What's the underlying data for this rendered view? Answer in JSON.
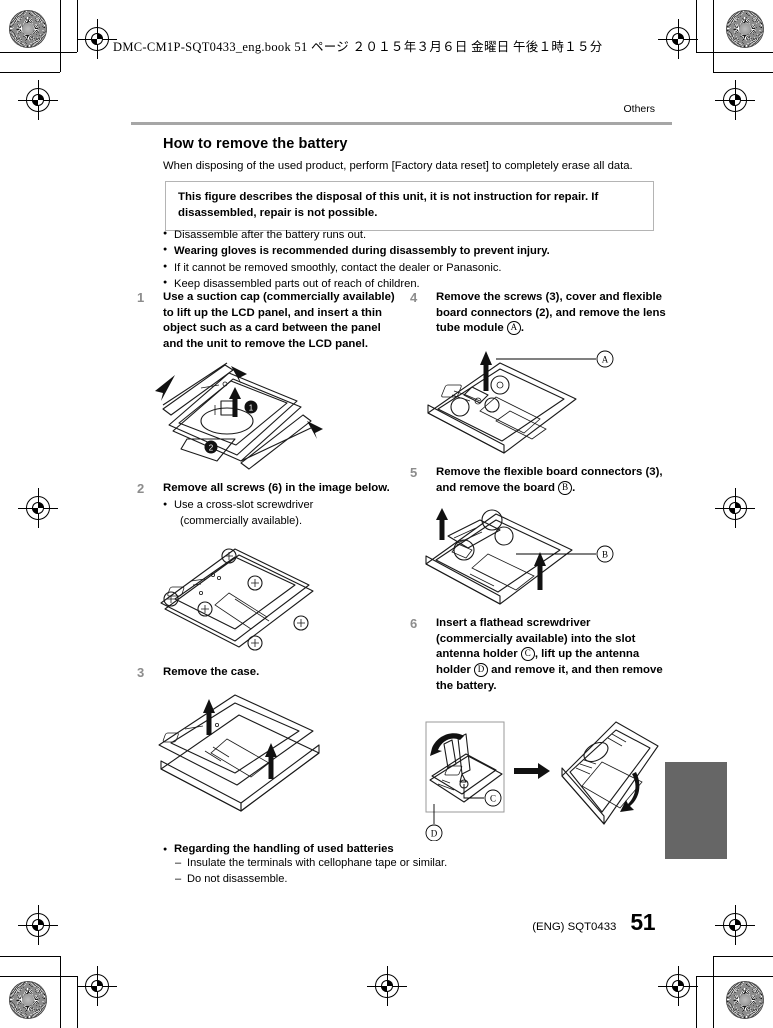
{
  "print_slug": "DMC-CM1P-SQT0433_eng.book   51 ページ   ２０１５年３月６日   金曜日   午後１時１５分",
  "running_head": "Others",
  "section": {
    "title": "How to remove the battery",
    "lead": "When disposing of the used product, perform [Factory data reset] to completely erase all data.",
    "warning_box": "This figure describes the disposal of this unit, it is not instruction for repair. If disassembled, repair is not possible."
  },
  "pre_notes": [
    {
      "text": "Disassemble after the battery runs out.",
      "bold": false
    },
    {
      "text": "Wearing gloves is recommended during disassembly to prevent injury.",
      "bold": true
    },
    {
      "text": "If it cannot be removed smoothly, contact the dealer or Panasonic.",
      "bold": false
    },
    {
      "text": "Keep disassembled parts out of reach of children.",
      "bold": false
    }
  ],
  "steps": {
    "s1": {
      "num": "1",
      "text": "Use a suction cap (commercially available) to lift up the LCD panel, and insert a thin object such as a card between the panel and the unit to remove the LCD panel."
    },
    "s2": {
      "num": "2",
      "text": "Remove all screws (6) in the image below.",
      "sub1": "Use a cross-slot screwdriver",
      "sub2": "(commercially available)."
    },
    "s3": {
      "num": "3",
      "text": "Remove the case."
    },
    "s4": {
      "num": "4",
      "text_a": "Remove the screws (3), cover and flexible board connectors (2), and remove the lens tube module ",
      "ref": "A",
      "text_b": "."
    },
    "s5": {
      "num": "5",
      "text_a": "Remove the flexible board connectors (3), and remove the board ",
      "ref": "B",
      "text_b": "."
    },
    "s6": {
      "num": "6",
      "text_a": "Insert a flathead screwdriver (commercially available) into the slot antenna holder ",
      "ref_c": "C",
      "text_b": ", lift up the antenna holder ",
      "ref_d": "D",
      "text_c": " and remove it, and then remove the battery."
    }
  },
  "fig_labels": {
    "one": "1",
    "two": "2",
    "a": "A",
    "b": "B",
    "c": "C",
    "d": "D"
  },
  "bottom_note": {
    "heading": "Regarding the handling of used batteries",
    "items": [
      "Insulate the terminals with cellophane tape or similar.",
      "Do not disassemble."
    ]
  },
  "footer": {
    "code": "(ENG) SQT0433",
    "page": "51"
  },
  "colors": {
    "rule": "#a6a6a6",
    "step_number": "#8c8c8c",
    "thumb_tab": "#666666",
    "note_border": "#b4b4b4"
  }
}
